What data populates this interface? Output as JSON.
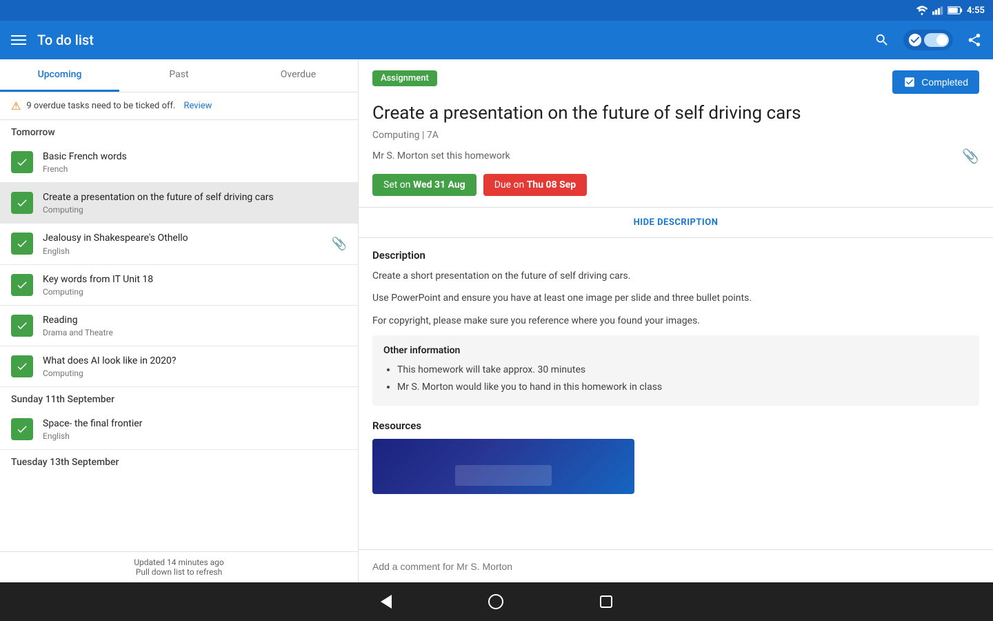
{
  "statusBar": {
    "time": "4:55",
    "icons": [
      "wifi",
      "signal",
      "battery"
    ]
  },
  "appBar": {
    "title": "To do list",
    "actions": [
      "search",
      "toggle",
      "share"
    ]
  },
  "tabs": [
    {
      "label": "Upcoming",
      "active": true
    },
    {
      "label": "Past",
      "active": false
    },
    {
      "label": "Overdue",
      "active": false
    }
  ],
  "warning": {
    "text": "9 overdue tasks need to be ticked off.",
    "linkText": "Review"
  },
  "sections": [
    {
      "header": "Tomorrow",
      "tasks": [
        {
          "name": "Basic French words",
          "subject": "French",
          "checked": true,
          "hasAttachment": false
        },
        {
          "name": "Create a presentation on the future of self driving cars",
          "subject": "Computing",
          "checked": true,
          "hasAttachment": false,
          "selected": true
        },
        {
          "name": "Jealousy in Shakespeare's Othello",
          "subject": "English",
          "checked": true,
          "hasAttachment": true
        },
        {
          "name": "Key words from IT Unit 18",
          "subject": "Computing",
          "checked": true,
          "hasAttachment": false
        },
        {
          "name": "Reading",
          "subject": "Drama and Theatre",
          "checked": true,
          "hasAttachment": false
        },
        {
          "name": "What does AI look like in 2020?",
          "subject": "Computing",
          "checked": true,
          "hasAttachment": false
        }
      ]
    },
    {
      "header": "Sunday 11th September",
      "tasks": [
        {
          "name": "Space- the final frontier",
          "subject": "English",
          "checked": true,
          "hasAttachment": false
        }
      ]
    },
    {
      "header": "Tuesday 13th September",
      "tasks": []
    }
  ],
  "updateBar": {
    "line1": "Updated 14 minutes ago",
    "line2": "Pull down list to refresh"
  },
  "detail": {
    "badge": "Assignment",
    "completedLabel": "Completed",
    "title": "Create a presentation on the future of self driving cars",
    "meta": "Computing | 7A",
    "teacher": "Mr S. Morton set this homework",
    "setLabel": "Set on",
    "setDate": "Wed 31 Aug",
    "dueLabel": "Due on",
    "dueDate": "Thu 08 Sep",
    "hideDescription": "HIDE DESCRIPTION",
    "descriptionTitle": "Description",
    "descriptionLines": [
      "Create a short presentation on the future of self driving cars.",
      "Use PowerPoint and ensure you have at least one image per slide and three bullet points.",
      "For copyright, please make sure you reference where you found your images."
    ],
    "otherInfoTitle": "Other information",
    "otherInfoItems": [
      "This homework will take approx. 30 minutes",
      "Mr S. Morton would like you to hand in this homework in class"
    ],
    "resourcesTitle": "Resources",
    "commentPlaceholder": "Add a comment for Mr S. Morton"
  }
}
